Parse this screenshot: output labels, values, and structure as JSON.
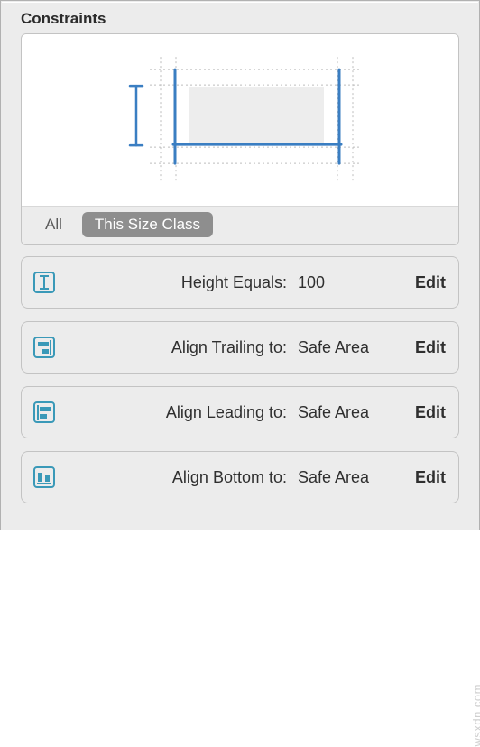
{
  "section": {
    "title": "Constraints"
  },
  "filter": {
    "all_label": "All",
    "size_class_label": "This Size Class"
  },
  "constraints": [
    {
      "icon": "height-icon",
      "label": "Height Equals:",
      "value": "100",
      "edit": "Edit"
    },
    {
      "icon": "align-trailing-icon",
      "label": "Align Trailing to:",
      "value": "Safe Area",
      "edit": "Edit"
    },
    {
      "icon": "align-leading-icon",
      "label": "Align Leading to:",
      "value": "Safe Area",
      "edit": "Edit"
    },
    {
      "icon": "align-bottom-icon",
      "label": "Align Bottom to:",
      "value": "Safe Area",
      "edit": "Edit"
    }
  ],
  "watermark": "wsxdn.com",
  "colors": {
    "accent": "#3a7ec2"
  }
}
